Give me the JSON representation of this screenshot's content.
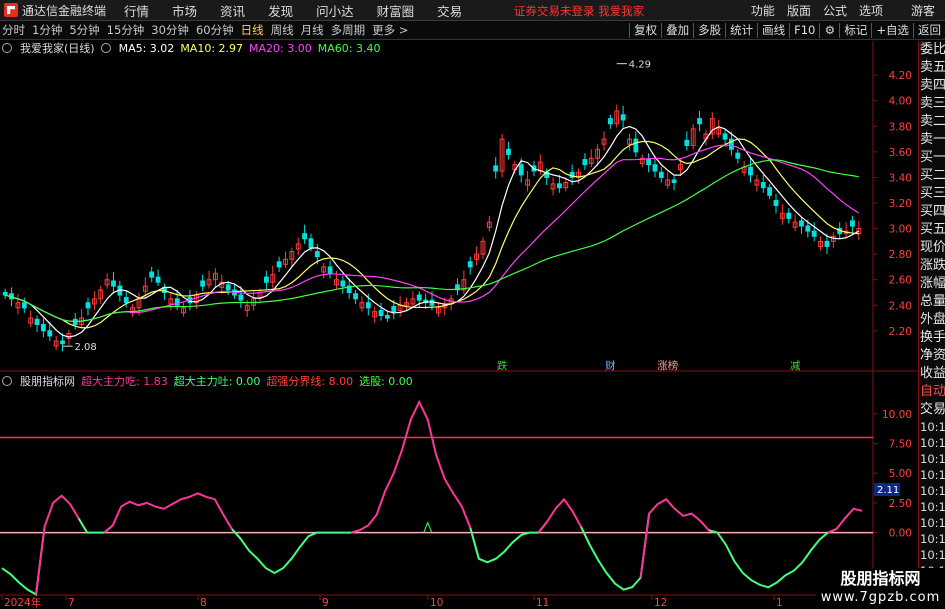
{
  "window": {
    "app_name": "通达信金融终端",
    "menu": [
      "行情",
      "市场",
      "资讯",
      "发现",
      "问小达",
      "财富圈",
      "交易"
    ],
    "notice": "证券交易未登录  我爱我家",
    "right_menu": [
      "功能",
      "版面",
      "公式",
      "选项"
    ],
    "guest": "游客"
  },
  "toolbar": {
    "periods": [
      "分时",
      "1分钟",
      "5分钟",
      "15分钟",
      "30分钟",
      "60分钟",
      "日线",
      "周线",
      "月线",
      "多周期",
      "更多 >"
    ],
    "active_period": "日线",
    "tools": [
      "复权",
      "叠加",
      "多股",
      "统计",
      "画线",
      "F10",
      "标记",
      "+自选",
      "返回"
    ]
  },
  "main_legend": {
    "title": "我爱我家(日线)",
    "ma5": "MA5: 3.02",
    "ma10": "MA10: 2.97",
    "ma20": "MA20: 3.00",
    "ma60": "MA60: 3.40"
  },
  "price_axis": [
    "4.20",
    "4.00",
    "3.80",
    "3.60",
    "3.40",
    "3.20",
    "3.00",
    "2.80",
    "2.60",
    "2.40",
    "2.20"
  ],
  "annotations": {
    "high": "4.29",
    "low": "2.08"
  },
  "event_tags": [
    {
      "label": "跌",
      "color": "#40d040"
    },
    {
      "label": "财",
      "color": "#6ab4ff"
    },
    {
      "label": "涨榜",
      "color": "#ff9a9a"
    },
    {
      "label": "减",
      "color": "#40d040"
    }
  ],
  "indicator_legend": {
    "name": "股朋指标网",
    "a": "超大主力吃: 1.83",
    "b": "超大主力吐: 0.00",
    "c": "超强分界线: 8.00",
    "d": "选股: 0.00"
  },
  "indicator_axis": [
    "10.00",
    "7.50",
    "5.00",
    "2.50",
    "0.00"
  ],
  "indicator_box": "2.11",
  "date_axis": [
    "2024年",
    "7",
    "8",
    "9",
    "10",
    "11",
    "12",
    "1"
  ],
  "sidebar": [
    "委比",
    "卖五",
    "卖四",
    "卖三",
    "卖二",
    "卖一",
    "买一",
    "买二",
    "买三",
    "买四",
    "买五",
    "现价",
    "涨跌",
    "涨幅",
    "总量",
    "外盘",
    "换手",
    "净资",
    "收益",
    "自动",
    "交易"
  ],
  "sidebar_times": [
    "10:18",
    "10:18",
    "10:19",
    "10:19",
    "10:19",
    "10:19",
    "10:19",
    "10:19",
    "10:19",
    "10:19"
  ],
  "watermark": {
    "line1": "股朋指标网",
    "line2": "www.7gpzb.com"
  },
  "colors": {
    "up": "#ff3c3c",
    "down": "#00e0e0",
    "ma5": "#ffffff",
    "ma10": "#ffff66",
    "ma20": "#ff40ff",
    "ma60": "#40ff40",
    "ind_red": "#ff3399",
    "ind_green": "#40ff7a",
    "ind_line": "#ff3030"
  },
  "chart_data": [
    {
      "type": "candlestick",
      "title": "我爱我家(日线)",
      "ylim": [
        2.05,
        4.35
      ],
      "x": [
        "2024年",
        "7",
        "8",
        "9",
        "10",
        "11",
        "12",
        "1"
      ],
      "note_values": {
        "MA5": 3.02,
        "MA10": 2.97,
        "MA20": 3.0,
        "MA60": 3.4
      },
      "close": [
        2.48,
        2.45,
        2.42,
        2.38,
        2.3,
        2.25,
        2.2,
        2.16,
        2.12,
        2.1,
        2.18,
        2.25,
        2.3,
        2.38,
        2.45,
        2.52,
        2.6,
        2.55,
        2.48,
        2.42,
        2.38,
        2.45,
        2.55,
        2.62,
        2.58,
        2.5,
        2.45,
        2.4,
        2.38,
        2.42,
        2.48,
        2.55,
        2.6,
        2.65,
        2.58,
        2.52,
        2.48,
        2.44,
        2.4,
        2.45,
        2.5,
        2.58,
        2.64,
        2.7,
        2.76,
        2.82,
        2.88,
        2.92,
        2.85,
        2.78,
        2.7,
        2.65,
        2.6,
        2.55,
        2.5,
        2.45,
        2.42,
        2.38,
        2.35,
        2.32,
        2.3,
        2.35,
        2.4,
        2.42,
        2.45,
        2.44,
        2.42,
        2.4,
        2.38,
        2.4,
        2.45,
        2.52,
        2.6,
        2.7,
        2.8,
        2.9,
        3.05,
        3.45,
        3.7,
        3.58,
        3.5,
        3.42,
        3.38,
        3.45,
        3.52,
        3.4,
        3.35,
        3.32,
        3.36,
        3.4,
        3.44,
        3.5,
        3.55,
        3.62,
        3.7,
        3.82,
        3.92,
        3.85,
        3.7,
        3.6,
        3.55,
        3.5,
        3.45,
        3.4,
        3.38,
        3.36,
        3.5,
        3.65,
        3.78,
        3.82,
        3.74,
        3.86,
        3.78,
        3.7,
        3.62,
        3.55,
        3.48,
        3.42,
        3.38,
        3.32,
        3.26,
        3.18,
        3.12,
        3.08,
        3.05,
        3.02,
        2.98,
        2.94,
        2.9,
        2.86,
        2.94,
        2.96,
        2.98,
        3.02,
        3.0
      ],
      "ma60_series_name": "MA60"
    },
    {
      "type": "line",
      "title": "股朋指标网",
      "ylim": [
        -5,
        12
      ],
      "x": [
        "2024年",
        "7",
        "8",
        "9",
        "10",
        "11",
        "12",
        "1"
      ],
      "series": [
        {
          "name": "超大主力吃",
          "values": [
            0,
            0,
            0,
            0,
            0,
            0.5,
            2.5,
            3.1,
            2.4,
            1.2,
            0,
            0,
            0,
            0.6,
            2.2,
            2.6,
            2.3,
            2.5,
            2.2,
            2.0,
            2.4,
            2.8,
            3.0,
            3.3,
            3.0,
            2.8,
            1.5,
            0.3,
            0,
            0,
            0,
            0,
            0,
            0,
            0,
            0,
            0,
            0,
            0,
            0,
            0,
            0,
            0.2,
            0.6,
            1.5,
            3.5,
            5.0,
            7.0,
            9.5,
            11.0,
            9.5,
            6.5,
            4.5,
            3.3,
            2.2,
            0.4,
            0,
            0,
            0,
            0,
            0,
            0,
            0,
            0,
            0.9,
            2.0,
            2.8,
            1.8,
            0.5,
            0,
            0,
            0,
            0,
            0,
            0,
            0,
            1.6,
            2.4,
            2.8,
            2.0,
            1.4,
            1.6,
            1.0,
            0.2,
            0,
            0,
            0,
            0,
            0,
            0,
            0,
            0,
            0,
            0,
            0,
            0,
            0,
            0,
            0.3,
            1.2,
            2.0,
            1.83
          ]
        },
        {
          "name": "超大主力吐",
          "values": [
            -3,
            -3.5,
            -4.2,
            -4.8,
            -5.2,
            -4.8,
            -4.0,
            -3.2,
            -2.0,
            -0.8,
            0,
            0,
            0,
            0,
            0,
            0,
            0,
            0,
            0,
            0,
            0,
            0,
            0,
            0,
            0,
            0,
            0,
            0,
            -0.5,
            -1.5,
            -2.2,
            -3.0,
            -3.4,
            -3.0,
            -2.2,
            -1.2,
            -0.3,
            0,
            0,
            0,
            0,
            0,
            0,
            0,
            0,
            0,
            0,
            0,
            0,
            0,
            0,
            0,
            0,
            0,
            0,
            -1.2,
            -2.2,
            -2.5,
            -2.2,
            -1.6,
            -0.8,
            -0.2,
            0,
            0,
            0,
            0,
            0,
            0,
            0,
            -1.0,
            -2.3,
            -3.4,
            -4.3,
            -4.8,
            -4.6,
            -3.8,
            -2.4,
            -0.9,
            0,
            0,
            0,
            0,
            0,
            0,
            0,
            -1.0,
            -2.4,
            -3.4,
            -4.0,
            -4.4,
            -4.6,
            -4.2,
            -3.6,
            -3.2,
            -2.5,
            -1.5,
            -0.6,
            0,
            0,
            0,
            0,
            0
          ]
        }
      ],
      "lines": [
        {
          "name": "超强分界线",
          "y": 8.0
        },
        {
          "name": "选股",
          "y": 0.0
        }
      ]
    }
  ]
}
